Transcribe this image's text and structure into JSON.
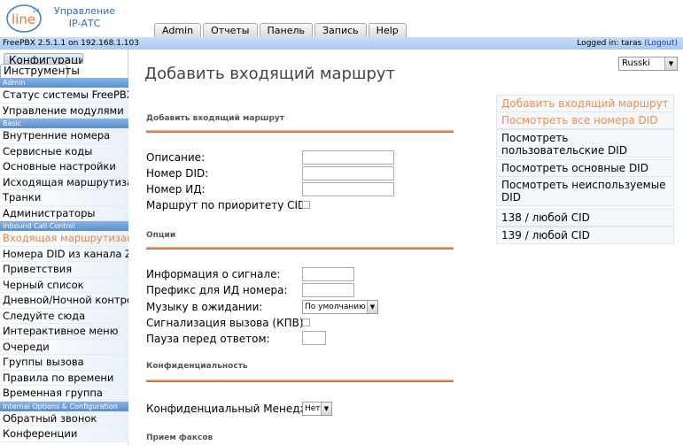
{
  "brand": {
    "line1": "Управление",
    "line2": "IP-АТС",
    "logo_text": "line"
  },
  "top_tabs": [
    "Admin",
    "Отчеты",
    "Панель",
    "Запись",
    "Help"
  ],
  "infobar": {
    "version": "FreePBX 2.5.1.1 on 192.168.1.103",
    "logged_in": "Logged in: taras",
    "logout": "(Logout)"
  },
  "sidebar": {
    "tab_config": "Конфигурация",
    "tab_tools": "Инструменты",
    "sections": [
      {
        "header": "Admin",
        "items": [
          "Статус системы FreePBX",
          "Управление модулями"
        ]
      },
      {
        "header": "Basic",
        "items": [
          "Внутренние номера",
          "Сервисные коды",
          "Основные настройки",
          "Исходящая маршрутизация",
          "Транки",
          "Администраторы"
        ]
      },
      {
        "header": "Inbound Call Control",
        "items": [
          "Входящая маршрутизация",
          "Номера DID из канала Zap",
          "Приветствия",
          "Черный список",
          "Дневной/Ночной контроль",
          "Следуйте сюда",
          "Интерактивное меню",
          "Очереди",
          "Группы вызова",
          "Правила по времени",
          "Временная группа"
        ]
      },
      {
        "header": "Internal Options & Configuration",
        "items": [
          "Обратный звонок",
          "Конференции"
        ]
      }
    ],
    "active_item": "Входящая маршрутизация"
  },
  "language": "Russki",
  "page_title": "Добавить входящий маршрут",
  "form": {
    "section1": "Добавить входящий маршрут",
    "description_label": "Описание:",
    "did_label": "Номер DID:",
    "cid_label": "Номер ИД:",
    "cid_priority_label": "Маршрут по приоритету CID:",
    "section2": "Опции",
    "alert_info_label": "Информация о сигнале:",
    "cid_prefix_label": "Префикс для ИД номера:",
    "moh_label": "Музыку в ожидании:",
    "moh_value": "По умолчанию",
    "ringing_label": "Сигнализация вызова (КПВ):",
    "pause_label": "Пауза перед ответом:",
    "section3": "Конфиденциальность",
    "privacy_label": "Конфиденциальный Менеджер:",
    "privacy_value": "Нет",
    "section4": "Прием факсов"
  },
  "right_links": [
    "Добавить входящий маршрут",
    "Посмотреть все номера DID",
    "Посмотреть пользовательские DID",
    "Посмотреть основные DID",
    "Посмотреть неиспользуемые DID"
  ],
  "routes": [
    "138 / любой CID",
    "139 / любой CID"
  ],
  "colors": {
    "accent_orange": "#f08040",
    "header_blue": "#5a8ed0",
    "brand_blue": "#2a6cc0"
  }
}
